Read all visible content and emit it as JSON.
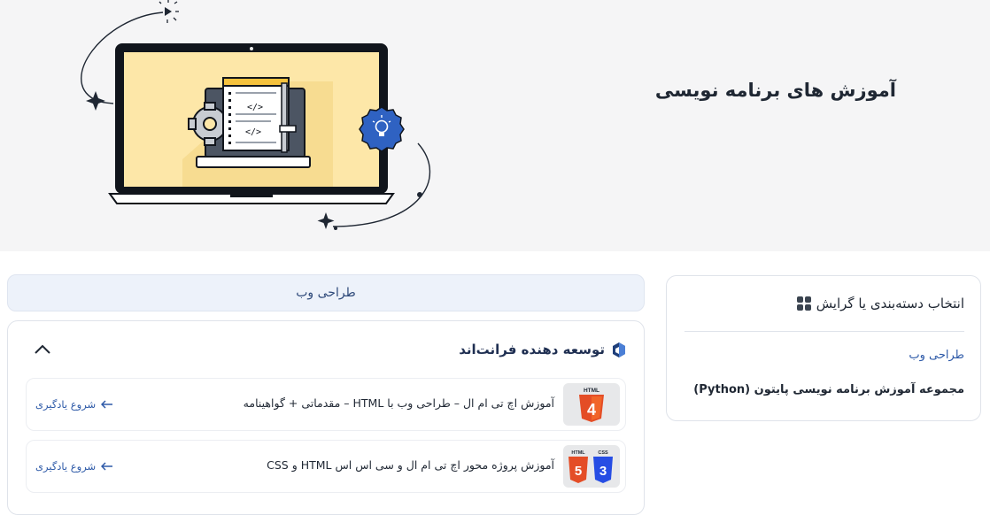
{
  "hero": {
    "title": "آموزش های برنامه نویسی",
    "colors": {
      "background": "#f5f5f6",
      "screen": "#fde7a8",
      "badge": "#2f62c2"
    }
  },
  "sidebar": {
    "heading": "انتخاب دسته‌بندی یا گرایش",
    "heading_icon": "grid-icon",
    "items": [
      {
        "label": "طراحی وب"
      },
      {
        "label": "مجموعه آموزش برنامه نویسی پایتون (Python)"
      }
    ]
  },
  "category_tab": {
    "label": "طراحی وب"
  },
  "section": {
    "title": "توسعه دهنده فرانت‌اند",
    "title_icon": "frontend-icon",
    "toggle_icon": "chevron-up-icon",
    "courses": [
      {
        "title": "آموزش اچ تی ام ال – طراحی وب با HTML – مقدماتی + گواهینامه",
        "link_label": "شروع یادگیری",
        "thumb_icon": "html5-icon",
        "thumb_labels": [
          "HTML",
          "4"
        ]
      },
      {
        "title": "آموزش پروژه محور اچ تی ام ال و سی اس اس HTML و CSS",
        "link_label": "شروع یادگیری",
        "thumb_icon": "html-css-icon",
        "thumb_labels": [
          "HTML",
          "CSS",
          "5",
          "3"
        ]
      }
    ]
  }
}
